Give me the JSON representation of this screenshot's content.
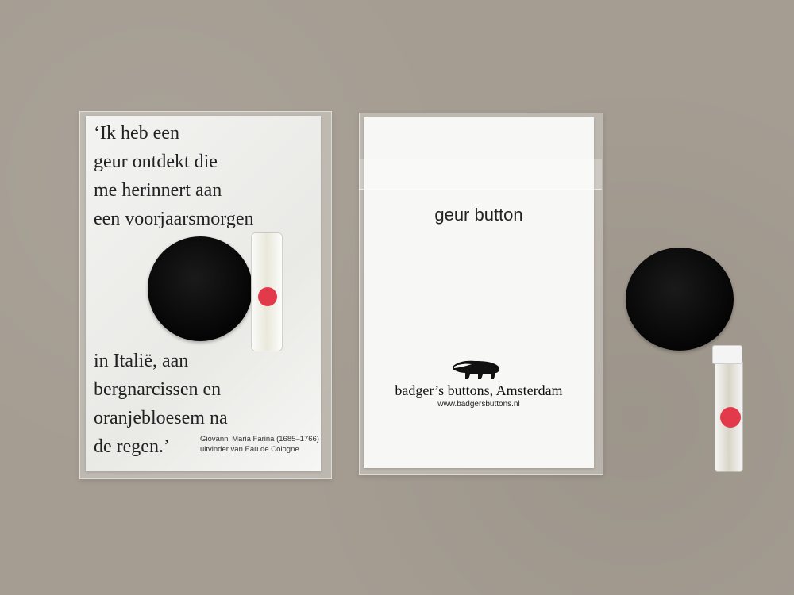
{
  "left_card": {
    "quote_top": [
      "‘Ik heb een",
      "geur ontdekt die",
      "me herinnert aan",
      "een voorjaarsmorgen"
    ],
    "quote_bottom": [
      "in Italië, aan",
      "bergnarcissen en",
      "oranjebloesem na",
      "de regen.’"
    ],
    "attribution_name": "Giovanni Maria Farina (1685–1766)",
    "attribution_role": "uitvinder van Eau de Cologne"
  },
  "middle_card": {
    "title": "geur button",
    "brand": "badger’s buttons, Amsterdam",
    "url": "www.badgersbuttons.nl",
    "icon": "badger-icon"
  },
  "colors": {
    "background": "#a59d92",
    "felt": "#0b0b0b",
    "red_dot": "#e23a4a",
    "card": "#f7f7f5"
  }
}
